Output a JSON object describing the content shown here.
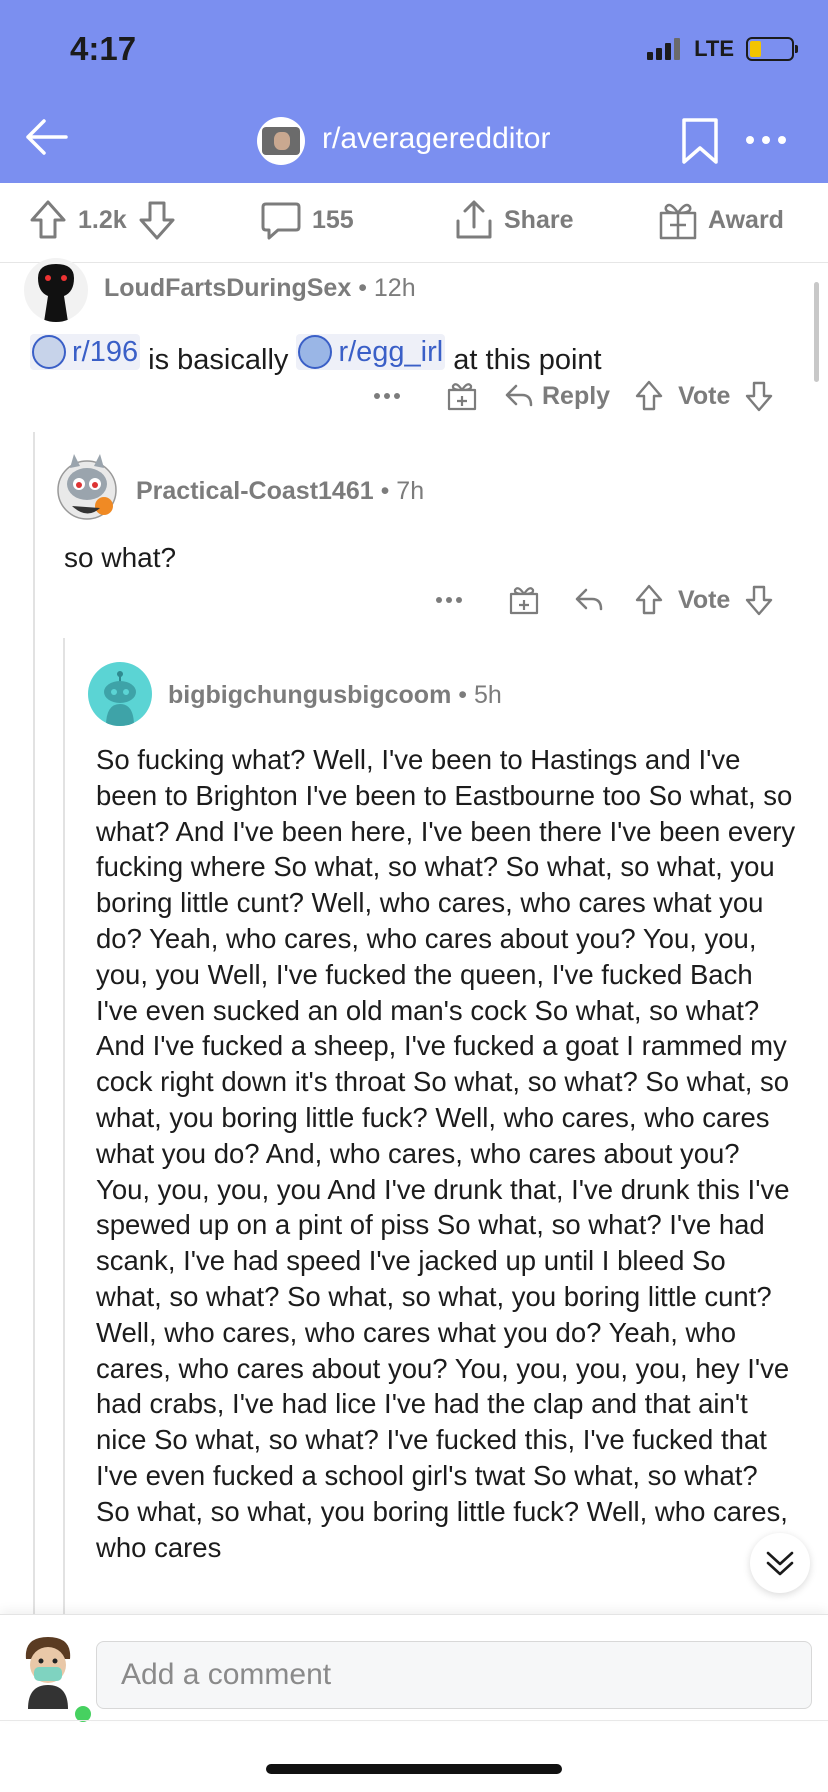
{
  "status": {
    "time": "4:17",
    "network": "LTE"
  },
  "header": {
    "subreddit": "r/averageredditor"
  },
  "post_bar": {
    "upvotes": "1.2k",
    "comments": "155",
    "share": "Share",
    "award": "Award"
  },
  "comments": [
    {
      "author": "LoudFartsDuringSex",
      "time": "12h",
      "body_chip1": "r/196",
      "body_mid": " is basically ",
      "body_chip2": "r/egg_irl",
      "body_end": " at this point",
      "reply": "Reply",
      "vote": "Vote"
    },
    {
      "author": "Practical-Coast1461",
      "time": "7h",
      "body": "so what?",
      "vote": "Vote"
    },
    {
      "author": "bigbigchungusbigcoom",
      "time": "5h",
      "body": "So fucking what? Well, I've been to Hastings and I've been to Brighton I've been to Eastbourne too So what, so what? And I've been here, I've been there I've been every fucking where So what, so what? So what, so what, you boring little cunt? Well, who cares, who cares what you do? Yeah, who cares, who cares about you? You, you, you, you Well, I've fucked the queen, I've fucked Bach I've even sucked an old man's cock So what, so what? And I've fucked a sheep, I've fucked a goat I rammed my cock right down it's throat So what, so what? So what, so what, you boring little fuck? Well, who cares, who cares what you do? And, who cares, who cares about you? You, you, you, you And I've drunk that, I've drunk this I've spewed up on a pint of piss So what, so what? I've had scank, I've had speed I've jacked up until I bleed So what, so what? So what, so what, you boring little cunt? Well, who cares, who cares what you do? Yeah, who cares, who cares about you? You, you, you, you, hey I've had crabs, I've had lice I've had the clap and that ain't nice So what, so what? I've fucked this, I've fucked that I've even fucked a school girl's twat So what, so what? So what, so what, you boring little fuck? Well, who cares, who cares"
    }
  ],
  "composer": {
    "placeholder": "Add a comment"
  }
}
